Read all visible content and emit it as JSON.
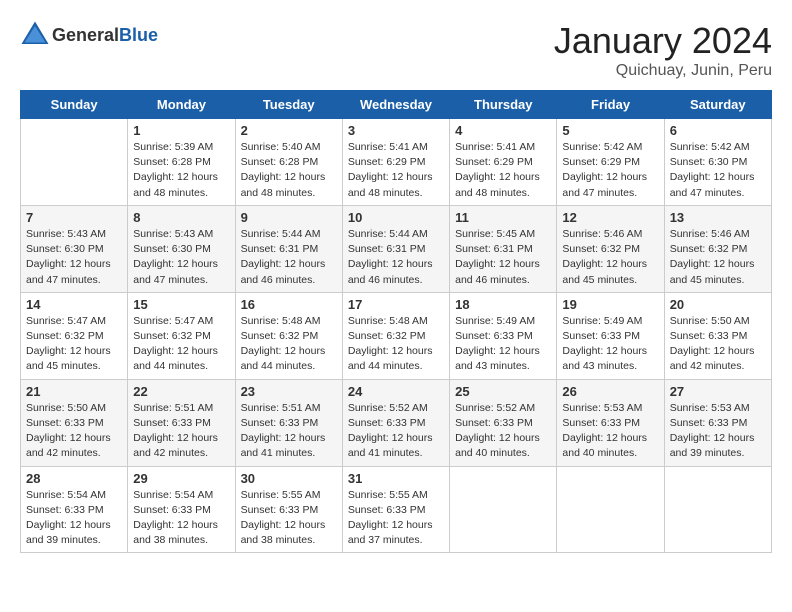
{
  "header": {
    "logo_general": "General",
    "logo_blue": "Blue",
    "month": "January 2024",
    "location": "Quichuay, Junin, Peru"
  },
  "days_of_week": [
    "Sunday",
    "Monday",
    "Tuesday",
    "Wednesday",
    "Thursday",
    "Friday",
    "Saturday"
  ],
  "weeks": [
    [
      {
        "day": "",
        "info": ""
      },
      {
        "day": "1",
        "info": "Sunrise: 5:39 AM\nSunset: 6:28 PM\nDaylight: 12 hours\nand 48 minutes."
      },
      {
        "day": "2",
        "info": "Sunrise: 5:40 AM\nSunset: 6:28 PM\nDaylight: 12 hours\nand 48 minutes."
      },
      {
        "day": "3",
        "info": "Sunrise: 5:41 AM\nSunset: 6:29 PM\nDaylight: 12 hours\nand 48 minutes."
      },
      {
        "day": "4",
        "info": "Sunrise: 5:41 AM\nSunset: 6:29 PM\nDaylight: 12 hours\nand 48 minutes."
      },
      {
        "day": "5",
        "info": "Sunrise: 5:42 AM\nSunset: 6:29 PM\nDaylight: 12 hours\nand 47 minutes."
      },
      {
        "day": "6",
        "info": "Sunrise: 5:42 AM\nSunset: 6:30 PM\nDaylight: 12 hours\nand 47 minutes."
      }
    ],
    [
      {
        "day": "7",
        "info": "Sunrise: 5:43 AM\nSunset: 6:30 PM\nDaylight: 12 hours\nand 47 minutes."
      },
      {
        "day": "8",
        "info": "Sunrise: 5:43 AM\nSunset: 6:30 PM\nDaylight: 12 hours\nand 47 minutes."
      },
      {
        "day": "9",
        "info": "Sunrise: 5:44 AM\nSunset: 6:31 PM\nDaylight: 12 hours\nand 46 minutes."
      },
      {
        "day": "10",
        "info": "Sunrise: 5:44 AM\nSunset: 6:31 PM\nDaylight: 12 hours\nand 46 minutes."
      },
      {
        "day": "11",
        "info": "Sunrise: 5:45 AM\nSunset: 6:31 PM\nDaylight: 12 hours\nand 46 minutes."
      },
      {
        "day": "12",
        "info": "Sunrise: 5:46 AM\nSunset: 6:32 PM\nDaylight: 12 hours\nand 45 minutes."
      },
      {
        "day": "13",
        "info": "Sunrise: 5:46 AM\nSunset: 6:32 PM\nDaylight: 12 hours\nand 45 minutes."
      }
    ],
    [
      {
        "day": "14",
        "info": "Sunrise: 5:47 AM\nSunset: 6:32 PM\nDaylight: 12 hours\nand 45 minutes."
      },
      {
        "day": "15",
        "info": "Sunrise: 5:47 AM\nSunset: 6:32 PM\nDaylight: 12 hours\nand 44 minutes."
      },
      {
        "day": "16",
        "info": "Sunrise: 5:48 AM\nSunset: 6:32 PM\nDaylight: 12 hours\nand 44 minutes."
      },
      {
        "day": "17",
        "info": "Sunrise: 5:48 AM\nSunset: 6:32 PM\nDaylight: 12 hours\nand 44 minutes."
      },
      {
        "day": "18",
        "info": "Sunrise: 5:49 AM\nSunset: 6:33 PM\nDaylight: 12 hours\nand 43 minutes."
      },
      {
        "day": "19",
        "info": "Sunrise: 5:49 AM\nSunset: 6:33 PM\nDaylight: 12 hours\nand 43 minutes."
      },
      {
        "day": "20",
        "info": "Sunrise: 5:50 AM\nSunset: 6:33 PM\nDaylight: 12 hours\nand 42 minutes."
      }
    ],
    [
      {
        "day": "21",
        "info": "Sunrise: 5:50 AM\nSunset: 6:33 PM\nDaylight: 12 hours\nand 42 minutes."
      },
      {
        "day": "22",
        "info": "Sunrise: 5:51 AM\nSunset: 6:33 PM\nDaylight: 12 hours\nand 42 minutes."
      },
      {
        "day": "23",
        "info": "Sunrise: 5:51 AM\nSunset: 6:33 PM\nDaylight: 12 hours\nand 41 minutes."
      },
      {
        "day": "24",
        "info": "Sunrise: 5:52 AM\nSunset: 6:33 PM\nDaylight: 12 hours\nand 41 minutes."
      },
      {
        "day": "25",
        "info": "Sunrise: 5:52 AM\nSunset: 6:33 PM\nDaylight: 12 hours\nand 40 minutes."
      },
      {
        "day": "26",
        "info": "Sunrise: 5:53 AM\nSunset: 6:33 PM\nDaylight: 12 hours\nand 40 minutes."
      },
      {
        "day": "27",
        "info": "Sunrise: 5:53 AM\nSunset: 6:33 PM\nDaylight: 12 hours\nand 39 minutes."
      }
    ],
    [
      {
        "day": "28",
        "info": "Sunrise: 5:54 AM\nSunset: 6:33 PM\nDaylight: 12 hours\nand 39 minutes."
      },
      {
        "day": "29",
        "info": "Sunrise: 5:54 AM\nSunset: 6:33 PM\nDaylight: 12 hours\nand 38 minutes."
      },
      {
        "day": "30",
        "info": "Sunrise: 5:55 AM\nSunset: 6:33 PM\nDaylight: 12 hours\nand 38 minutes."
      },
      {
        "day": "31",
        "info": "Sunrise: 5:55 AM\nSunset: 6:33 PM\nDaylight: 12 hours\nand 37 minutes."
      },
      {
        "day": "",
        "info": ""
      },
      {
        "day": "",
        "info": ""
      },
      {
        "day": "",
        "info": ""
      }
    ]
  ]
}
